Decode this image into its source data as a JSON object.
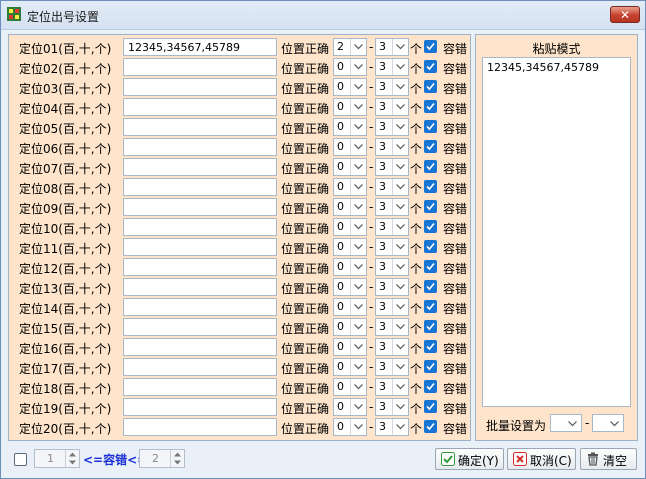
{
  "window": {
    "title": "定位出号设置",
    "close_glyph": "✕"
  },
  "rows": [
    {
      "label": "定位01(百,十,个)",
      "value": "12345,34567,45789",
      "min": "2",
      "max": "3"
    },
    {
      "label": "定位02(百,十,个)",
      "value": "",
      "min": "0",
      "max": "3"
    },
    {
      "label": "定位03(百,十,个)",
      "value": "",
      "min": "0",
      "max": "3"
    },
    {
      "label": "定位04(百,十,个)",
      "value": "",
      "min": "0",
      "max": "3"
    },
    {
      "label": "定位05(百,十,个)",
      "value": "",
      "min": "0",
      "max": "3"
    },
    {
      "label": "定位06(百,十,个)",
      "value": "",
      "min": "0",
      "max": "3"
    },
    {
      "label": "定位07(百,十,个)",
      "value": "",
      "min": "0",
      "max": "3"
    },
    {
      "label": "定位08(百,十,个)",
      "value": "",
      "min": "0",
      "max": "3"
    },
    {
      "label": "定位09(百,十,个)",
      "value": "",
      "min": "0",
      "max": "3"
    },
    {
      "label": "定位10(百,十,个)",
      "value": "",
      "min": "0",
      "max": "3"
    },
    {
      "label": "定位11(百,十,个)",
      "value": "",
      "min": "0",
      "max": "3"
    },
    {
      "label": "定位12(百,十,个)",
      "value": "",
      "min": "0",
      "max": "3"
    },
    {
      "label": "定位13(百,十,个)",
      "value": "",
      "min": "0",
      "max": "3"
    },
    {
      "label": "定位14(百,十,个)",
      "value": "",
      "min": "0",
      "max": "3"
    },
    {
      "label": "定位15(百,十,个)",
      "value": "",
      "min": "0",
      "max": "3"
    },
    {
      "label": "定位16(百,十,个)",
      "value": "",
      "min": "0",
      "max": "3"
    },
    {
      "label": "定位17(百,十,个)",
      "value": "",
      "min": "0",
      "max": "3"
    },
    {
      "label": "定位18(百,十,个)",
      "value": "",
      "min": "0",
      "max": "3"
    },
    {
      "label": "定位19(百,十,个)",
      "value": "",
      "min": "0",
      "max": "3"
    },
    {
      "label": "定位20(百,十,个)",
      "value": "",
      "min": "0",
      "max": "3"
    }
  ],
  "labels": {
    "position_correct": "位置正确",
    "dash": "-",
    "unit": "个",
    "tolerance": "容错"
  },
  "paste": {
    "title": "粘贴模式",
    "content": "12345,34567,45789",
    "batch_label": "批量设置为",
    "batch_dash": "-"
  },
  "bottom": {
    "spin_min": "1",
    "spin_max": "2",
    "range_text": "<=容错<=",
    "ok": "确定(Y)",
    "cancel": "取消(C)",
    "clear": "清空"
  },
  "colors": {
    "accent": "#1874d2",
    "panel_bg": "#fde4cb",
    "range_text": "#1a2fd6"
  }
}
